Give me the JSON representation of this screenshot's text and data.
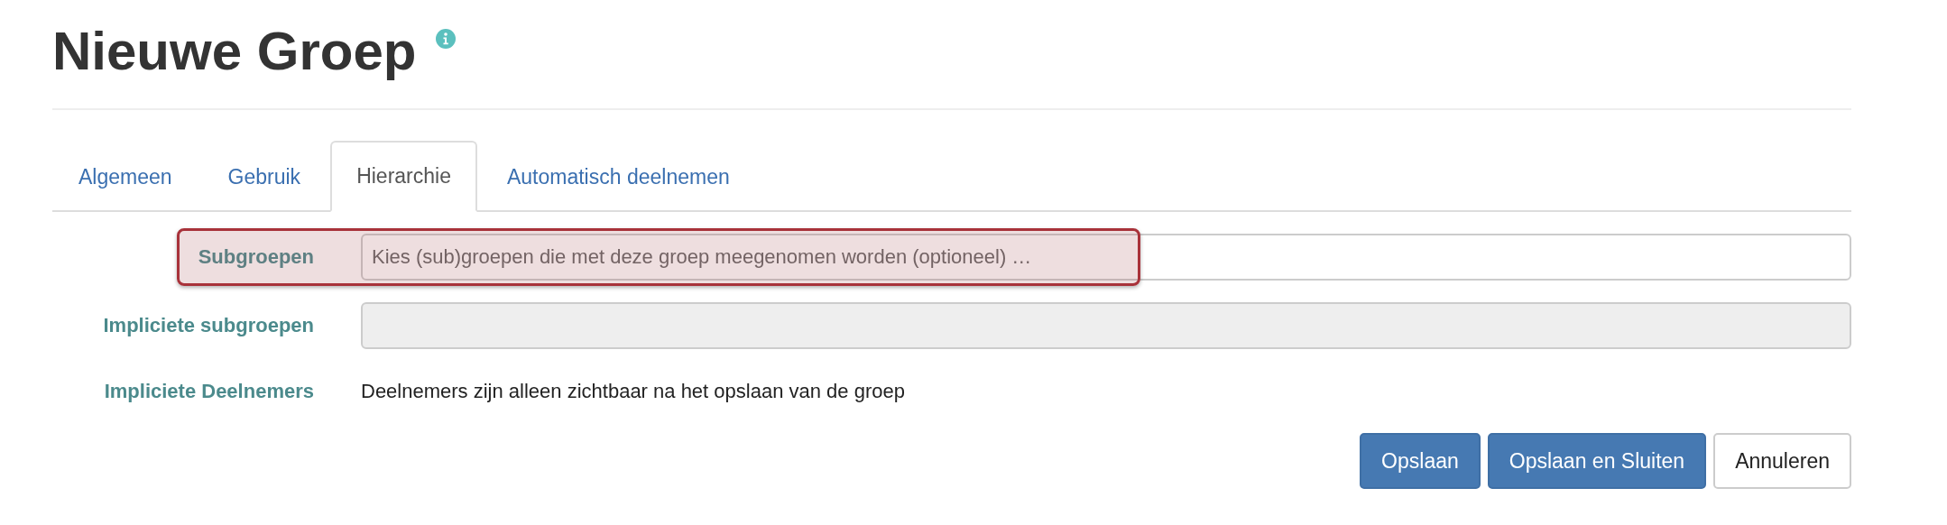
{
  "page": {
    "title": "Nieuwe Groep"
  },
  "tabs": [
    {
      "label": "Algemeen",
      "selected": false
    },
    {
      "label": "Gebruik",
      "selected": false
    },
    {
      "label": "Hierarchie",
      "selected": true
    },
    {
      "label": "Automatisch deelnemen",
      "selected": false
    }
  ],
  "fields": [
    {
      "kind": "input",
      "label": "Subgroepen",
      "placeholder": "Kies (sub)groepen die met deze groep meegenomen worden (optioneel) …",
      "disabled": false,
      "highlighted": true
    },
    {
      "kind": "input",
      "label": "Impliciete subgroepen",
      "disabled": true,
      "highlighted": false
    },
    {
      "kind": "text",
      "label": "Impliciete Deelnemers",
      "text": "Deelnemers zijn alleen zichtbaar na het opslaan van de groep",
      "highlighted": false
    }
  ],
  "buttons": [
    {
      "label": "Opslaan",
      "primary": true
    },
    {
      "label": "Opslaan en Sluiten",
      "primary": true
    },
    {
      "label": "Annuleren",
      "primary": false
    }
  ]
}
